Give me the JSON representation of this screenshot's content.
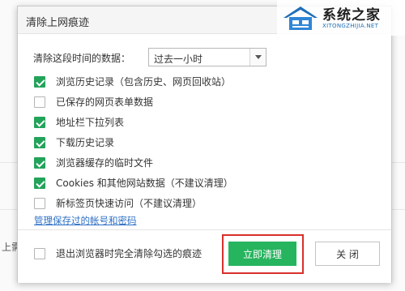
{
  "dialog": {
    "title": "清除上网痕迹"
  },
  "watermark": {
    "name": "系统之家",
    "url": "XITONGZHIJIA.NET"
  },
  "background": {
    "partial_text": "上需"
  },
  "range": {
    "label": "清除这段时间的数据：",
    "selected": "过去一小时"
  },
  "options": [
    {
      "label": "浏览历史记录（包含历史、网页回收站）",
      "checked": true
    },
    {
      "label": "已保存的网页表单数据",
      "checked": false
    },
    {
      "label": "地址栏下拉列表",
      "checked": true
    },
    {
      "label": "下载历史记录",
      "checked": true
    },
    {
      "label": "浏览器缓存的临时文件",
      "checked": true
    },
    {
      "label": "Cookies 和其他网站数据（不建议清理）",
      "checked": true
    },
    {
      "label": "新标签页快速访问（不建议清理）",
      "checked": false
    }
  ],
  "manage_link": "管理保存过的帐号和密码",
  "footer": {
    "exit_label": "退出浏览器时完全清除勾选的痕迹",
    "exit_checked": false,
    "clear_button": "立即清理",
    "close_button": "关 闭"
  },
  "colors": {
    "accent_green": "#27b45f",
    "checkbox_green": "#23a35a",
    "highlight_red": "#d8302b",
    "link_blue": "#2d6fc4"
  }
}
